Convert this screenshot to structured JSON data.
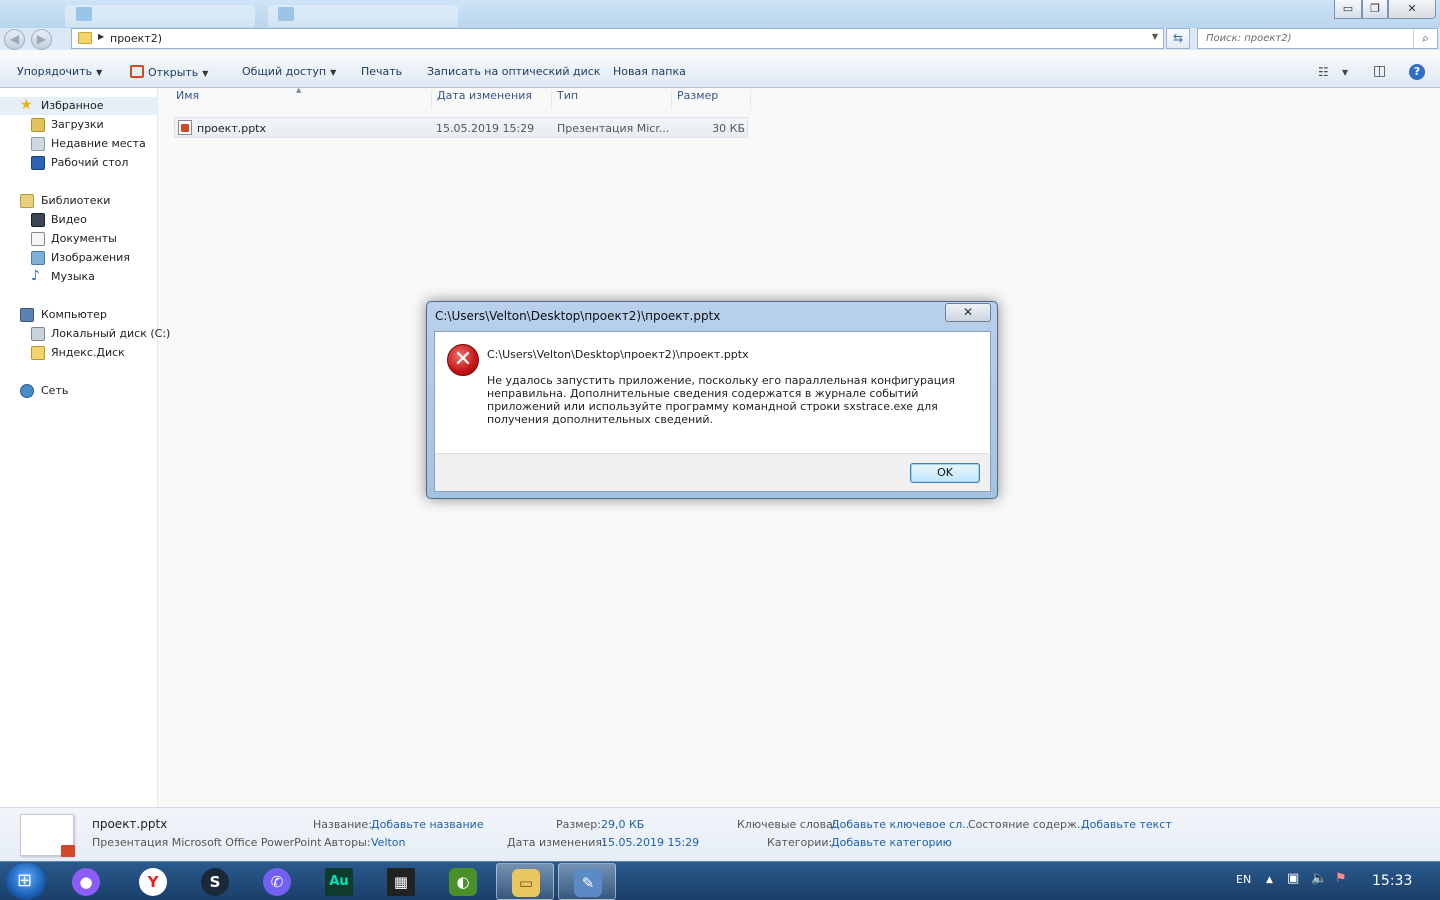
{
  "window": {
    "address_crumb": "проект2)",
    "search_placeholder": "Поиск: проект2)",
    "controls": {
      "minimize": "▭",
      "maximize": "❐",
      "close": "✕"
    }
  },
  "toolbar": {
    "organize": "Упорядочить",
    "open": "Открыть",
    "share": "Общий доступ",
    "print": "Печать",
    "burn": "Записать на оптический диск",
    "new_folder": "Новая папка"
  },
  "sidebar": {
    "favorites": {
      "label": "Избранное",
      "items": [
        "Загрузки",
        "Недавние места",
        "Рабочий стол"
      ]
    },
    "libraries": {
      "label": "Библиотеки",
      "items": [
        "Видео",
        "Документы",
        "Изображения",
        "Музыка"
      ]
    },
    "computer": {
      "label": "Компьютер",
      "items": [
        "Локальный диск (C:)",
        "Яндекс.Диск"
      ]
    },
    "network": {
      "label": "Сеть"
    }
  },
  "file_list": {
    "columns": {
      "name": "Имя",
      "modified": "Дата изменения",
      "type": "Тип",
      "size": "Размер"
    },
    "rows": [
      {
        "name": "проект.pptx",
        "modified": "15.05.2019 15:29",
        "type": "Презентация Micr...",
        "size": "30 КБ"
      }
    ]
  },
  "dialog": {
    "title": "C:\\Users\\Velton\\Desktop\\проект2)\\проект.pptx",
    "close": "✕",
    "path": "C:\\Users\\Velton\\Desktop\\проект2)\\проект.pptx",
    "message": "Не удалось запустить приложение, поскольку его параллельная конфигурация неправильна. Дополнительные сведения содержатся в журнале событий приложений или используйте программу командной строки sxstrace.exe для получения дополнительных сведений.",
    "ok": "OK"
  },
  "details": {
    "filename": "проект.pptx",
    "filetype": "Презентация Microsoft Office PowerPoint",
    "title_key": "Название:",
    "title_val": "Добавьте название",
    "authors_key": "Авторы:",
    "authors_val": "Velton",
    "size_key": "Размер:",
    "size_val": "29,0 КБ",
    "modified_key": "Дата изменения:",
    "modified_val": "15.05.2019 15:29",
    "keywords_key": "Ключевые слова:",
    "keywords_val": "Добавьте ключевое сл...",
    "status_key": "Состояние содерж...",
    "status_val": "Добавьте текст",
    "category_key": "Категории:",
    "category_val": "Добавьте категорию"
  },
  "taskbar": {
    "apps": [
      {
        "id": "alice",
        "glyph": "●",
        "color": "#8b5cf6"
      },
      {
        "id": "yandex-browser",
        "glyph": "Y",
        "color": "#e02424"
      },
      {
        "id": "steam",
        "glyph": "S",
        "color": "#1b2838"
      },
      {
        "id": "viber",
        "glyph": "✆",
        "color": "#7360f2"
      },
      {
        "id": "audition",
        "glyph": "Au",
        "color": "#0e3b2e"
      },
      {
        "id": "video-editor",
        "glyph": "▦",
        "color": "#222222"
      },
      {
        "id": "game",
        "glyph": "◐",
        "color": "#4a8f2a"
      },
      {
        "id": "explorer",
        "glyph": "▭",
        "color": "#e9c760"
      },
      {
        "id": "paint",
        "glyph": "✎",
        "color": "#5b8ac4"
      }
    ],
    "lang": "EN",
    "time": "15:33"
  }
}
